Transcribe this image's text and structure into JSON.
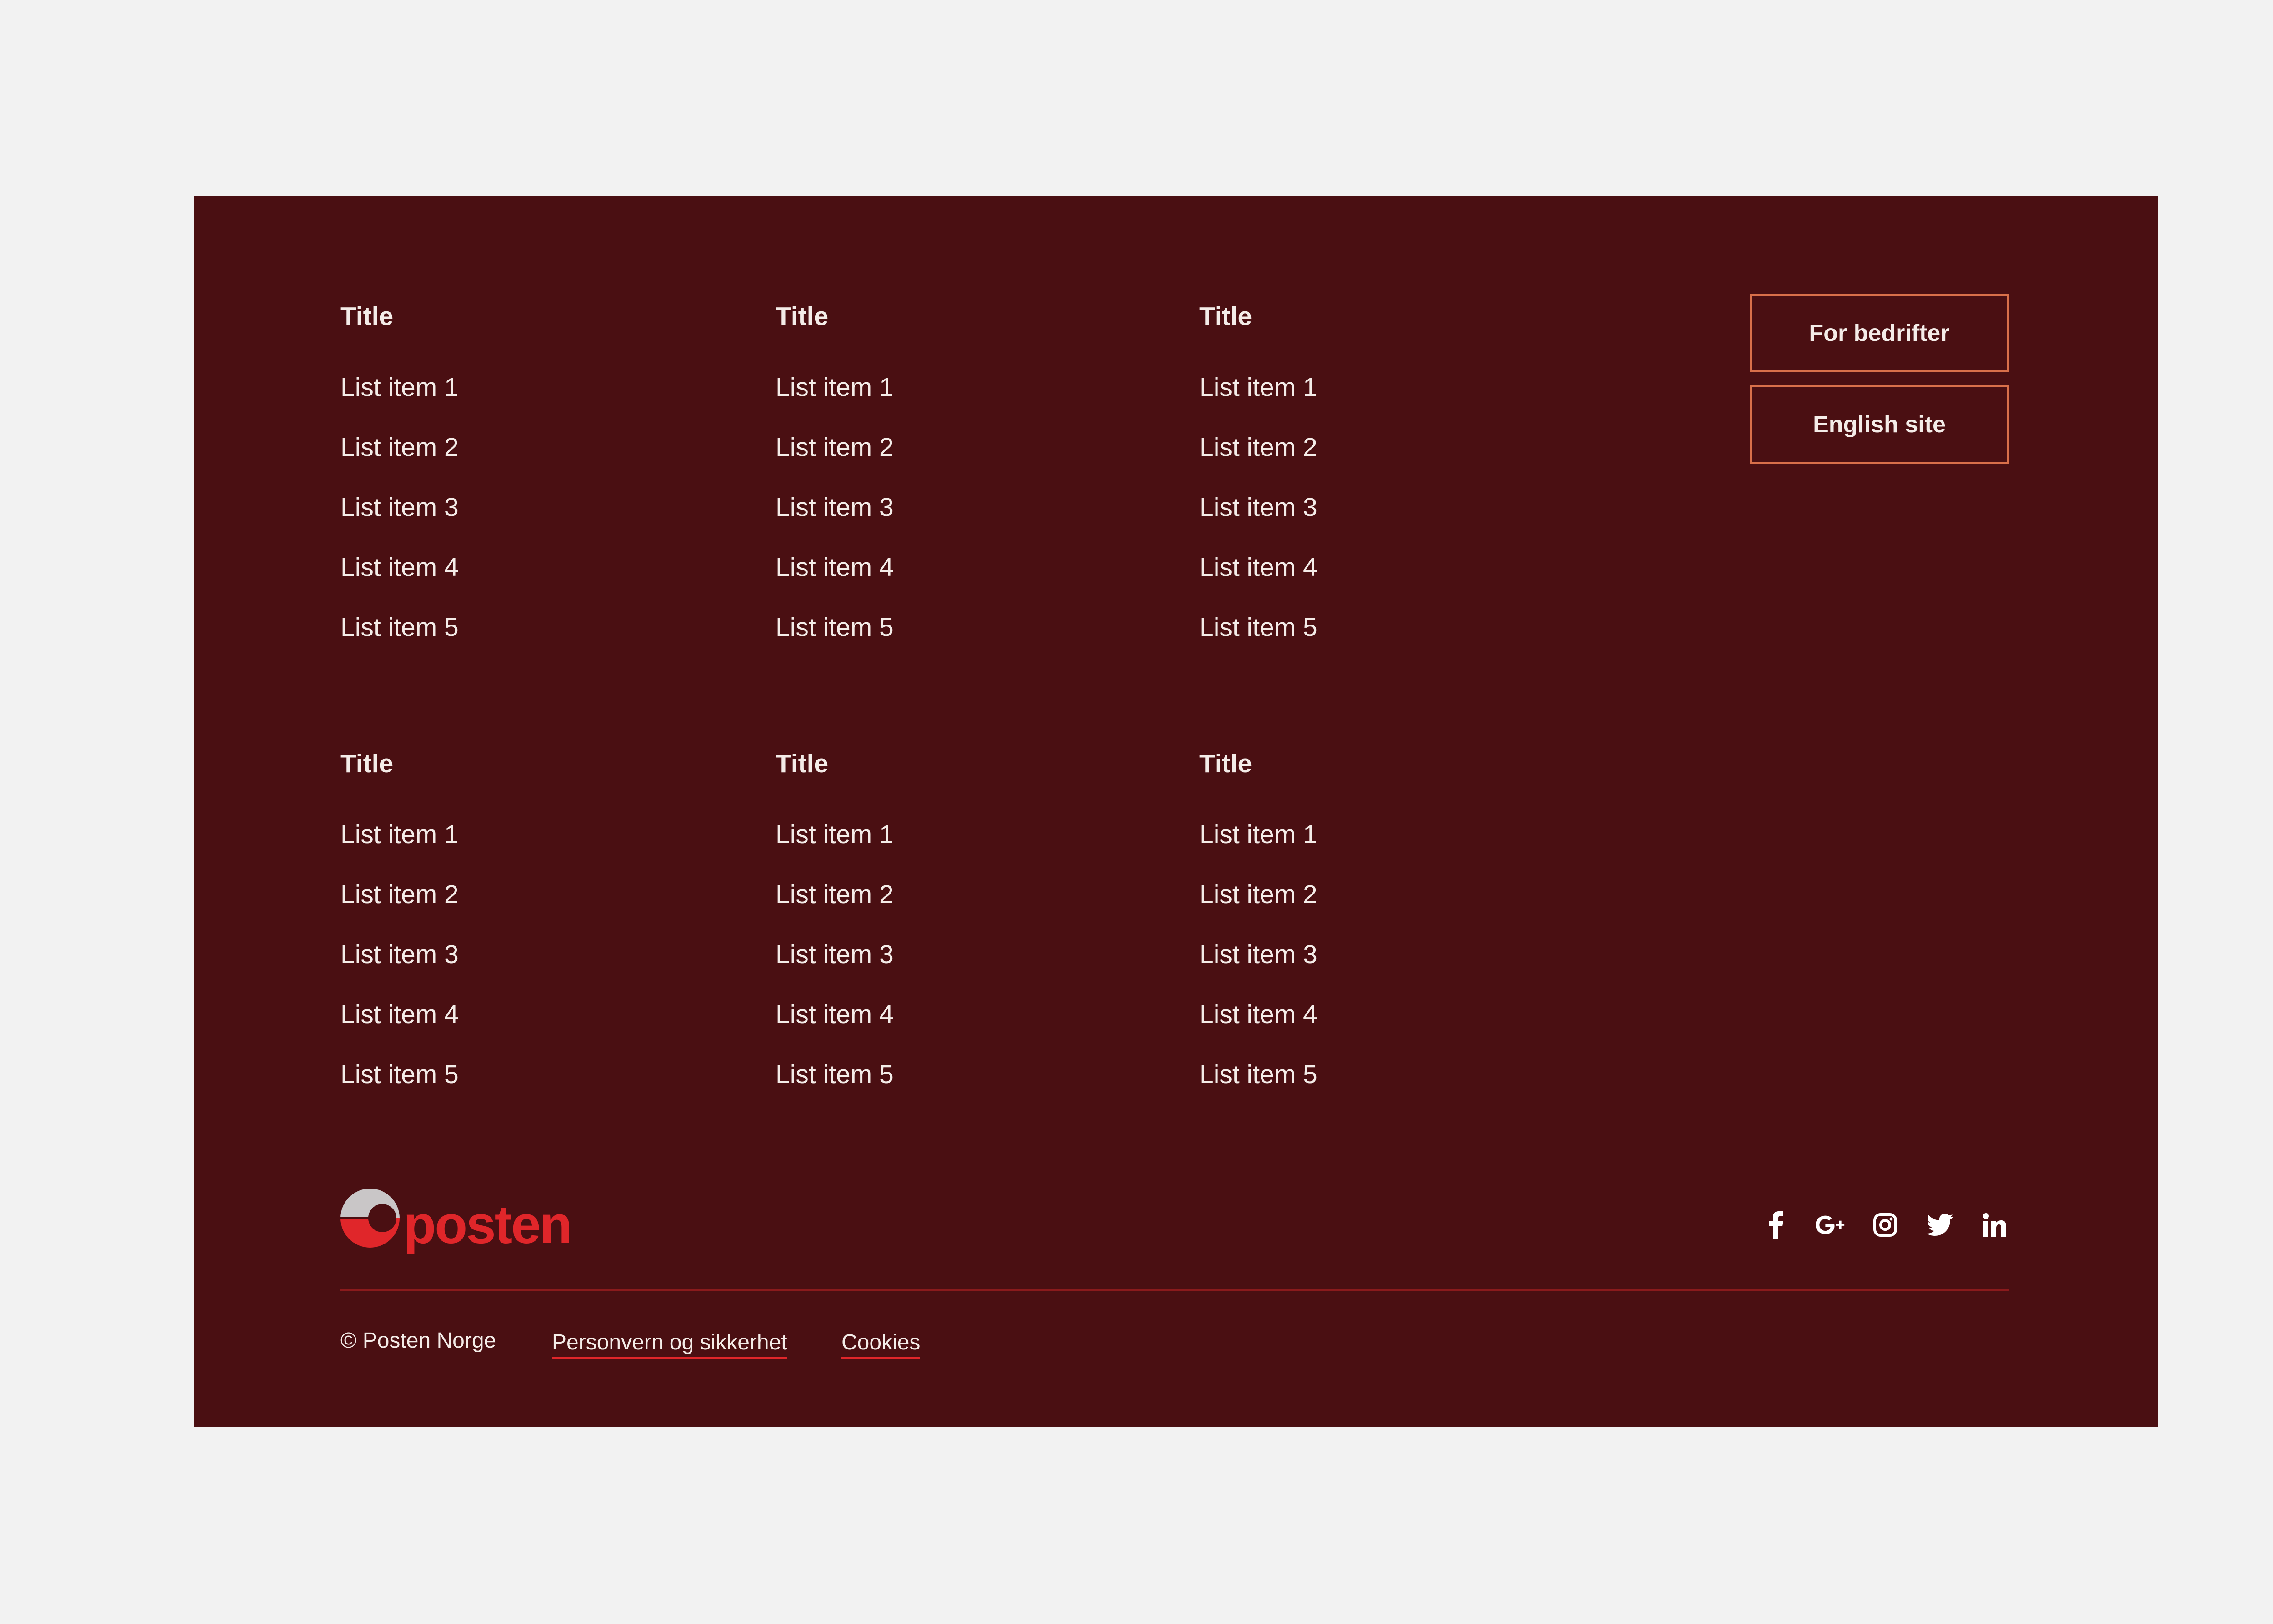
{
  "footer": {
    "columns": [
      {
        "title": "Title",
        "items": [
          "List item 1",
          "List item 2",
          "List item 3",
          "List item 4",
          "List item 5"
        ]
      },
      {
        "title": "Title",
        "items": [
          "List item 1",
          "List item 2",
          "List item 3",
          "List item 4",
          "List item 5"
        ]
      },
      {
        "title": "Title",
        "items": [
          "List item 1",
          "List item 2",
          "List item 3",
          "List item 4",
          "List item 5"
        ]
      },
      {
        "title": "Title",
        "items": [
          "List item 1",
          "List item 2",
          "List item 3",
          "List item 4",
          "List item 5"
        ]
      },
      {
        "title": "Title",
        "items": [
          "List item 1",
          "List item 2",
          "List item 3",
          "List item 4",
          "List item 5"
        ]
      },
      {
        "title": "Title",
        "items": [
          "List item 1",
          "List item 2",
          "List item 3",
          "List item 4",
          "List item 5"
        ]
      }
    ],
    "buttons": {
      "business": "For bedrifter",
      "english": "English site"
    },
    "logo_text": "posten",
    "social_icons": [
      "facebook-icon",
      "google-plus-icon",
      "instagram-icon",
      "twitter-icon",
      "linkedin-icon"
    ],
    "copyright": "© Posten Norge",
    "links": {
      "privacy": "Personvern og sikkerhet",
      "cookies": "Cookies"
    }
  },
  "colors": {
    "page_background": "#f2f2f2",
    "footer_background": "#4a0f12",
    "text": "#f4ece8",
    "button_border": "#d9704a",
    "accent_red": "#e0262a",
    "logo_grey": "#c9c6c7"
  }
}
